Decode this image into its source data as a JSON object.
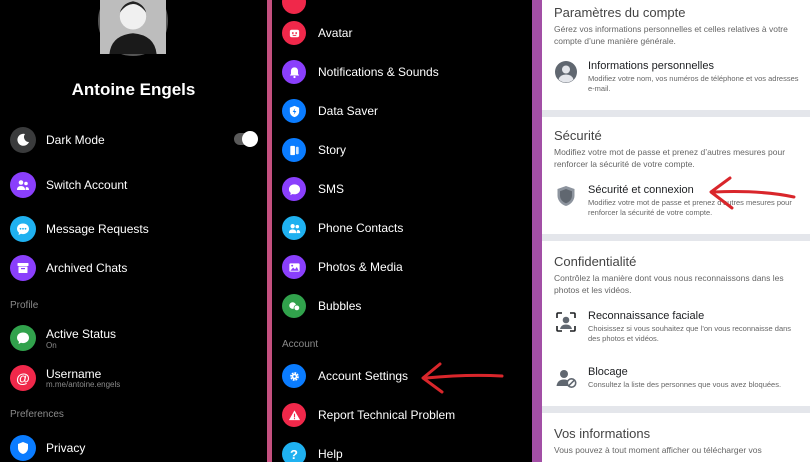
{
  "profile": {
    "name": "Antoine Engels"
  },
  "menu_left": {
    "dark_mode": "Dark Mode",
    "switch_account": "Switch Account",
    "message_requests": "Message Requests",
    "archived_chats": "Archived Chats",
    "profile_header": "Profile",
    "active_status": "Active Status",
    "active_status_value": "On",
    "username": "Username",
    "username_value": "m.me/antoine.engels",
    "preferences_header": "Preferences",
    "privacy": "Privacy"
  },
  "menu_right": {
    "items": [
      "Avatar",
      "Notifications & Sounds",
      "Data Saver",
      "Story",
      "SMS",
      "Phone Contacts",
      "Photos & Media",
      "Bubbles"
    ],
    "account_header": "Account",
    "account_settings": "Account Settings",
    "report_problem": "Report Technical Problem",
    "help": "Help"
  },
  "settings": {
    "general": {
      "title": "Paramètres du compte",
      "desc": "Gérez vos informations personnelles et celles relatives à votre compte d’une manière générale.",
      "item_title": "Informations personnelles",
      "item_desc": "Modifiez votre nom, vos numéros de téléphone et vos adresses e-mail."
    },
    "security": {
      "title": "Sécurité",
      "desc": "Modifiez votre mot de passe et prenez d’autres mesures pour renforcer la sécurité de votre compte.",
      "item_title": "Sécurité et connexion",
      "item_desc": "Modifiez votre mot de passe et prenez d’autres mesures pour renforcer la sécurité de votre compte."
    },
    "privacy": {
      "title": "Confidentialité",
      "desc": "Contrôlez la manière dont vous nous reconnaissons dans les photos et les vidéos.",
      "face_title": "Reconnaissance faciale",
      "face_desc": "Choisissez si vous souhaitez que l’on vous reconnaisse dans des photos et vidéos.",
      "block_title": "Blocage",
      "block_desc": "Consultez la liste des personnes que vous avez bloquées."
    },
    "info": {
      "title": "Vos informations",
      "desc": "Vous pouvez à tout moment afficher ou télécharger vos"
    }
  },
  "colors": {
    "accent_purple": "#8a3ffc",
    "accent_blue": "#0a7cff",
    "accent_cyan": "#1fb1f0",
    "annotation_red": "#d9262b"
  }
}
